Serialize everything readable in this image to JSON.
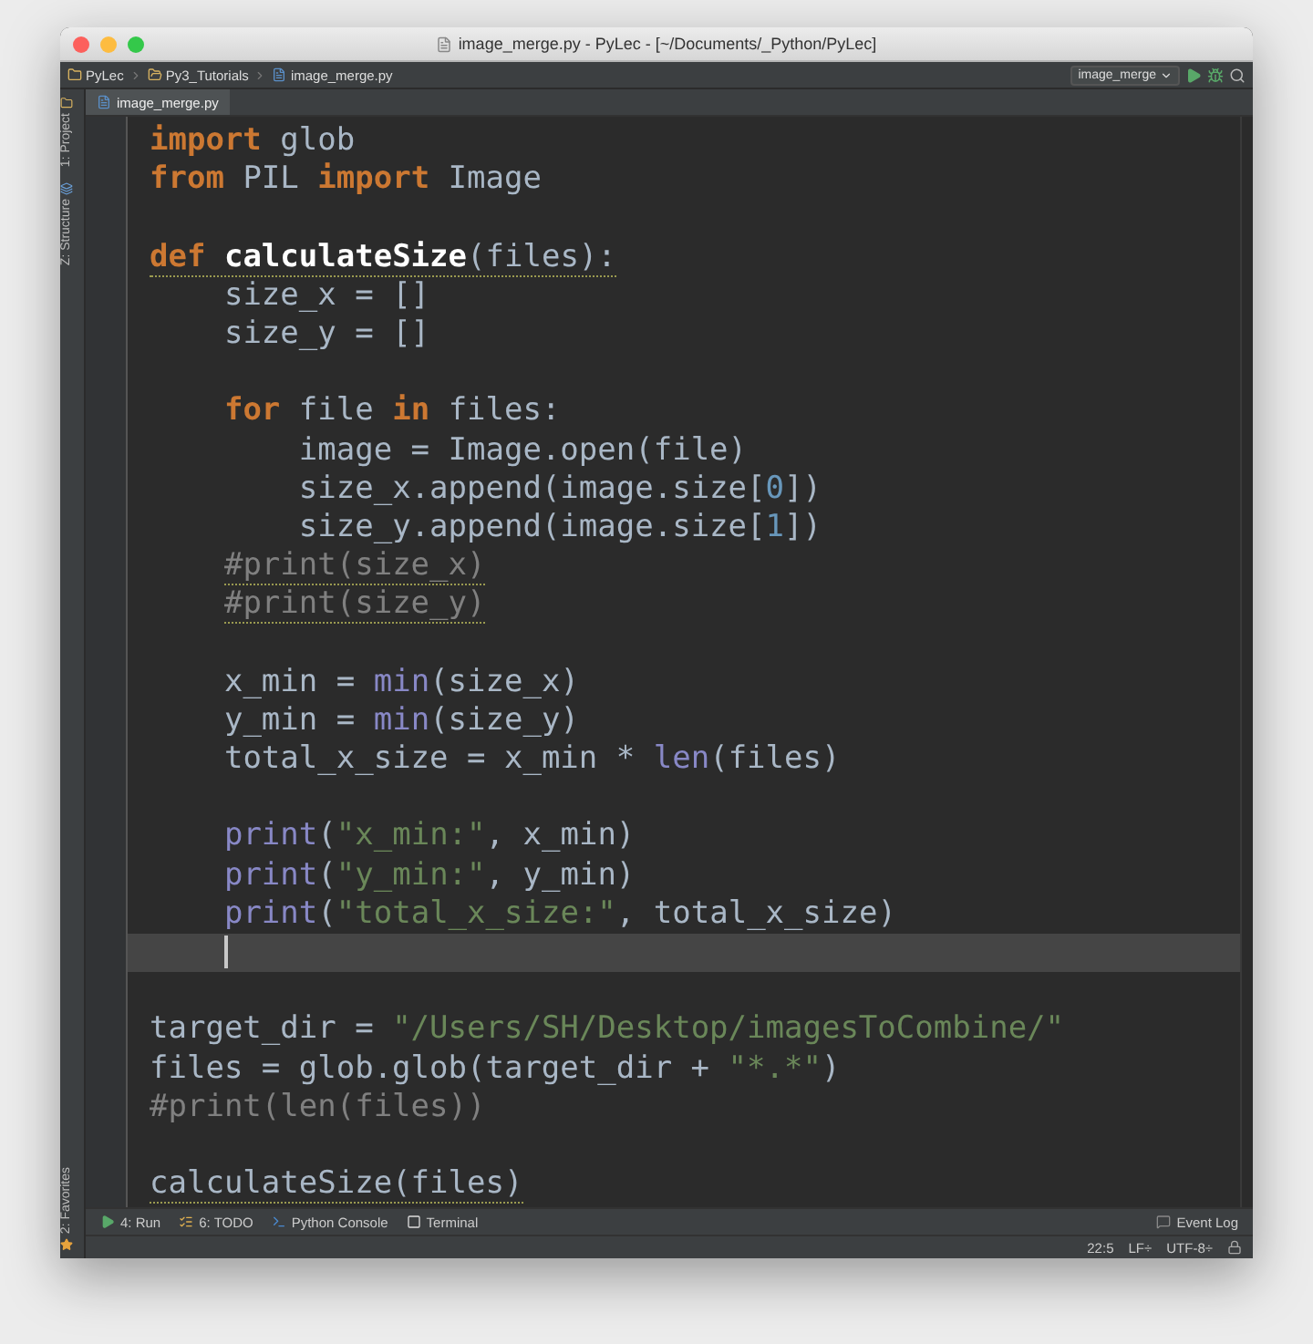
{
  "window": {
    "title": "image_merge.py - PyLec - [~/Documents/_Python/PyLec]"
  },
  "breadcrumbs": [
    {
      "label": "PyLec",
      "kind": "project"
    },
    {
      "label": "Py3_Tutorials",
      "kind": "folder"
    },
    {
      "label": "image_merge.py",
      "kind": "file"
    }
  ],
  "run_config": {
    "label": "image_merge"
  },
  "tabs": [
    {
      "label": "image_merge.py",
      "selected": true
    }
  ],
  "left_tool_windows": [
    {
      "label": "1: Project",
      "kind": "project"
    },
    {
      "label": "Z: Structure",
      "kind": "structure"
    }
  ],
  "left_bottom_tool_windows": [
    {
      "label": "2: Favorites",
      "kind": "favorites"
    }
  ],
  "editor": {
    "lines": [
      {
        "tokens": [
          {
            "text": "import",
            "kind": "keyword"
          },
          {
            "text": " glob",
            "kind": "plain"
          }
        ],
        "warned": false,
        "current": false
      },
      {
        "tokens": [
          {
            "text": "from",
            "kind": "keyword"
          },
          {
            "text": " PIL ",
            "kind": "plain"
          },
          {
            "text": "import",
            "kind": "keyword"
          },
          {
            "text": " Image",
            "kind": "plain"
          }
        ],
        "warned": false,
        "current": false
      },
      {
        "current": false
      },
      {
        "tokens": [
          {
            "text": "def",
            "kind": "keyword"
          },
          {
            "text": " calculateSize",
            "kind": "function"
          },
          {
            "text": "(files):",
            "kind": "plain"
          }
        ],
        "warned": true,
        "current": false
      },
      {
        "tokens": [
          {
            "text": "    size_x = []",
            "kind": "plain"
          }
        ],
        "warned": false,
        "current": false
      },
      {
        "tokens": [
          {
            "text": "    size_y = []",
            "kind": "plain"
          }
        ],
        "warned": false,
        "current": false
      },
      {
        "current": false
      },
      {
        "tokens": [
          {
            "text": "    for",
            "kind": "keyword"
          },
          {
            "text": " file ",
            "kind": "plain"
          },
          {
            "text": "in",
            "kind": "keyword"
          },
          {
            "text": " files:",
            "kind": "plain"
          }
        ],
        "warned": false,
        "current": false
      },
      {
        "tokens": [
          {
            "text": "        image = Image.open(file)",
            "kind": "plain"
          }
        ],
        "warned": false,
        "current": false
      },
      {
        "tokens": [
          {
            "text": "        size_x.append(image.size[",
            "kind": "plain"
          },
          {
            "text": "0",
            "kind": "number"
          },
          {
            "text": "])",
            "kind": "plain"
          }
        ],
        "warned": false,
        "current": false
      },
      {
        "tokens": [
          {
            "text": "        size_y.append(image.size[",
            "kind": "plain"
          },
          {
            "text": "1",
            "kind": "number"
          },
          {
            "text": "])",
            "kind": "plain"
          }
        ],
        "warned": false,
        "current": false
      },
      {
        "tokens": [
          {
            "text": "    #print(size_x)",
            "kind": "comment"
          }
        ],
        "warned": true,
        "current": false
      },
      {
        "tokens": [
          {
            "text": "    #print(size_y)",
            "kind": "comment"
          }
        ],
        "warned": true,
        "current": false
      },
      {
        "current": false
      },
      {
        "tokens": [
          {
            "text": "    x_min = ",
            "kind": "plain"
          },
          {
            "text": "min",
            "kind": "builtin"
          },
          {
            "text": "(size_x)",
            "kind": "plain"
          }
        ],
        "warned": false,
        "current": false
      },
      {
        "tokens": [
          {
            "text": "    y_min = ",
            "kind": "plain"
          },
          {
            "text": "min",
            "kind": "builtin"
          },
          {
            "text": "(size_y)",
            "kind": "plain"
          }
        ],
        "warned": false,
        "current": false
      },
      {
        "tokens": [
          {
            "text": "    total_x_size = x_min * ",
            "kind": "plain"
          },
          {
            "text": "len",
            "kind": "builtin"
          },
          {
            "text": "(files)",
            "kind": "plain"
          }
        ],
        "warned": false,
        "current": false
      },
      {
        "current": false
      },
      {
        "tokens": [
          {
            "text": "    print",
            "kind": "builtin"
          },
          {
            "text": "(",
            "kind": "plain"
          },
          {
            "text": "\"x_min:\"",
            "kind": "string"
          },
          {
            "text": ", x_min)",
            "kind": "plain"
          }
        ],
        "warned": false,
        "current": false
      },
      {
        "tokens": [
          {
            "text": "    print",
            "kind": "builtin"
          },
          {
            "text": "(",
            "kind": "plain"
          },
          {
            "text": "\"y_min:\"",
            "kind": "string"
          },
          {
            "text": ", y_min)",
            "kind": "plain"
          }
        ],
        "warned": false,
        "current": false
      },
      {
        "tokens": [
          {
            "text": "    print",
            "kind": "builtin"
          },
          {
            "text": "(",
            "kind": "plain"
          },
          {
            "text": "\"total_x_size:\"",
            "kind": "string"
          },
          {
            "text": ", total_x_size)",
            "kind": "plain"
          }
        ],
        "warned": false,
        "current": false
      },
      {
        "current": true
      },
      {
        "current": false
      },
      {
        "tokens": [
          {
            "text": "target_dir = ",
            "kind": "plain"
          },
          {
            "text": "\"/Users/SH/Desktop/imagesToCombine/\"",
            "kind": "string"
          }
        ],
        "warned": false,
        "current": false
      },
      {
        "tokens": [
          {
            "text": "files = glob.glob(target_dir + ",
            "kind": "plain"
          },
          {
            "text": "\"*.*\"",
            "kind": "string"
          },
          {
            "text": ")",
            "kind": "plain"
          }
        ],
        "warned": false,
        "current": false
      },
      {
        "tokens": [
          {
            "text": "#print(len(files))",
            "kind": "comment"
          }
        ],
        "warned": false,
        "current": false
      },
      {
        "current": false
      },
      {
        "tokens": [
          {
            "text": "calculateSize(files)",
            "kind": "plain"
          }
        ],
        "warned": true,
        "current": false
      }
    ]
  },
  "tool_windows": [
    {
      "label": "4: Run",
      "kind": "run"
    },
    {
      "label": "6: TODO",
      "kind": "todo"
    },
    {
      "label": "Python Console",
      "kind": "console"
    },
    {
      "label": "Terminal",
      "kind": "terminal"
    }
  ],
  "event_log": {
    "label": "Event Log"
  },
  "status_bar": {
    "position": "22:5",
    "line_sep": "LF÷",
    "encoding": "UTF-8÷"
  }
}
